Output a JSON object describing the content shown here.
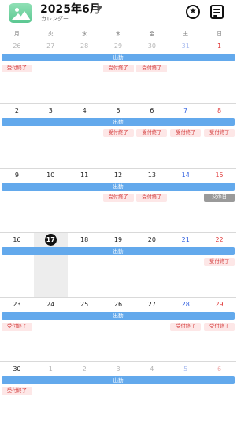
{
  "header": {
    "title": "2025年6月",
    "subtitle": "カレンダー",
    "favorites_icon": "star-circle-icon",
    "notes_icon": "note-icon",
    "app_icon": "image-icon"
  },
  "weekdays": [
    "月",
    "火",
    "水",
    "木",
    "金",
    "土",
    "日"
  ],
  "event_bar_label": "出勤",
  "chip_label": "受付終了",
  "holiday_label": "父の日",
  "colors": {
    "bar": "#63a9ec",
    "chip_bg": "#fde7e7",
    "chip_text": "#d43c3c",
    "saturday": "#2f5fe0",
    "sunday": "#e03b3b",
    "holiday": "#9a9a9a"
  },
  "weeks": [
    {
      "days": [
        "26",
        "27",
        "28",
        "29",
        "30",
        "31",
        "1"
      ],
      "faded": [
        1,
        1,
        1,
        1,
        1,
        1,
        0
      ],
      "chips": [
        0,
        3,
        4
      ],
      "holiday": null,
      "today": null
    },
    {
      "days": [
        "2",
        "3",
        "4",
        "5",
        "6",
        "7",
        "8"
      ],
      "faded": [
        0,
        0,
        0,
        0,
        0,
        0,
        0
      ],
      "chips": [
        3,
        4,
        5,
        6
      ],
      "holiday": null,
      "today": null
    },
    {
      "days": [
        "9",
        "10",
        "11",
        "12",
        "13",
        "14",
        "15"
      ],
      "faded": [
        0,
        0,
        0,
        0,
        0,
        0,
        0
      ],
      "chips": [
        3,
        4
      ],
      "holiday": 6,
      "today": null
    },
    {
      "days": [
        "16",
        "17",
        "18",
        "19",
        "20",
        "21",
        "22"
      ],
      "faded": [
        0,
        0,
        0,
        0,
        0,
        0,
        0
      ],
      "chips": [
        6
      ],
      "holiday": null,
      "today": 1
    },
    {
      "days": [
        "23",
        "24",
        "25",
        "26",
        "27",
        "28",
        "29"
      ],
      "faded": [
        0,
        0,
        0,
        0,
        0,
        0,
        0
      ],
      "chips": [
        0,
        5,
        6
      ],
      "holiday": null,
      "today": null
    },
    {
      "days": [
        "30",
        "1",
        "2",
        "3",
        "4",
        "5",
        "6"
      ],
      "faded": [
        0,
        1,
        1,
        1,
        1,
        1,
        1
      ],
      "chips": [
        0
      ],
      "holiday": null,
      "today": null
    }
  ]
}
